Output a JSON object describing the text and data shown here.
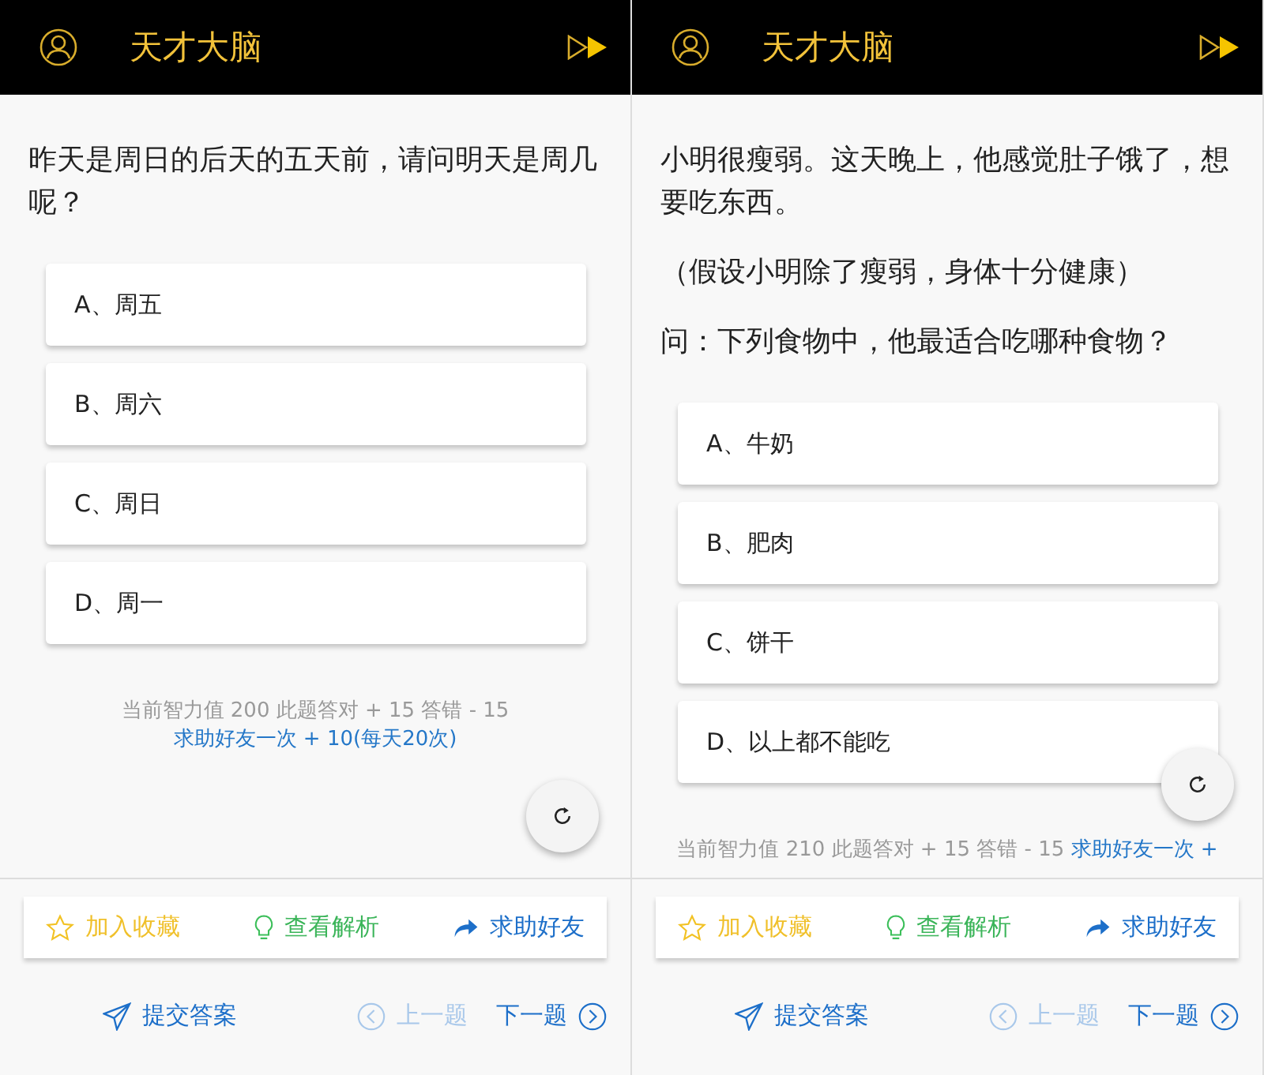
{
  "screens": [
    {
      "header": {
        "title": "天才大脑"
      },
      "question": [
        "昨天是周日的后天的五天前，请问明天是周几呢？"
      ],
      "options": [
        {
          "label": "A、周五"
        },
        {
          "label": "B、周六"
        },
        {
          "label": "C、周日"
        },
        {
          "label": "D、周一"
        }
      ],
      "score": {
        "text": "当前智力值 200 此题答对 + 15 答错 - 15",
        "link": "求助好友一次 + 10(每天20次)"
      },
      "actions": [
        {
          "kind": "favorite",
          "label": "加入收藏"
        },
        {
          "kind": "hint",
          "label": "查看解析"
        },
        {
          "kind": "share",
          "label": "求助好友"
        }
      ],
      "nav": {
        "submit": "提交答案",
        "prev": {
          "label": "上一题",
          "disabled": true
        },
        "next": {
          "label": "下一题",
          "disabled": false
        }
      }
    },
    {
      "header": {
        "title": "天才大脑"
      },
      "question": [
        "小明很瘦弱。这天晚上，他感觉肚子饿了，想要吃东西。",
        "（假设小明除了瘦弱，身体十分健康）",
        "问：下列食物中，他最适合吃哪种食物？"
      ],
      "options": [
        {
          "label": "A、牛奶"
        },
        {
          "label": "B、肥肉"
        },
        {
          "label": "C、饼干"
        },
        {
          "label": "D、以上都不能吃"
        }
      ],
      "score": {
        "text": "当前智力值 210 此题答对 + 15 答错 - 15",
        "link": "求助好友一次 +"
      },
      "actions": [
        {
          "kind": "favorite",
          "label": "加入收藏"
        },
        {
          "kind": "hint",
          "label": "查看解析"
        },
        {
          "kind": "share",
          "label": "求助好友"
        }
      ],
      "nav": {
        "submit": "提交答案",
        "prev": {
          "label": "上一题",
          "disabled": true
        },
        "next": {
          "label": "下一题",
          "disabled": false
        }
      }
    }
  ]
}
